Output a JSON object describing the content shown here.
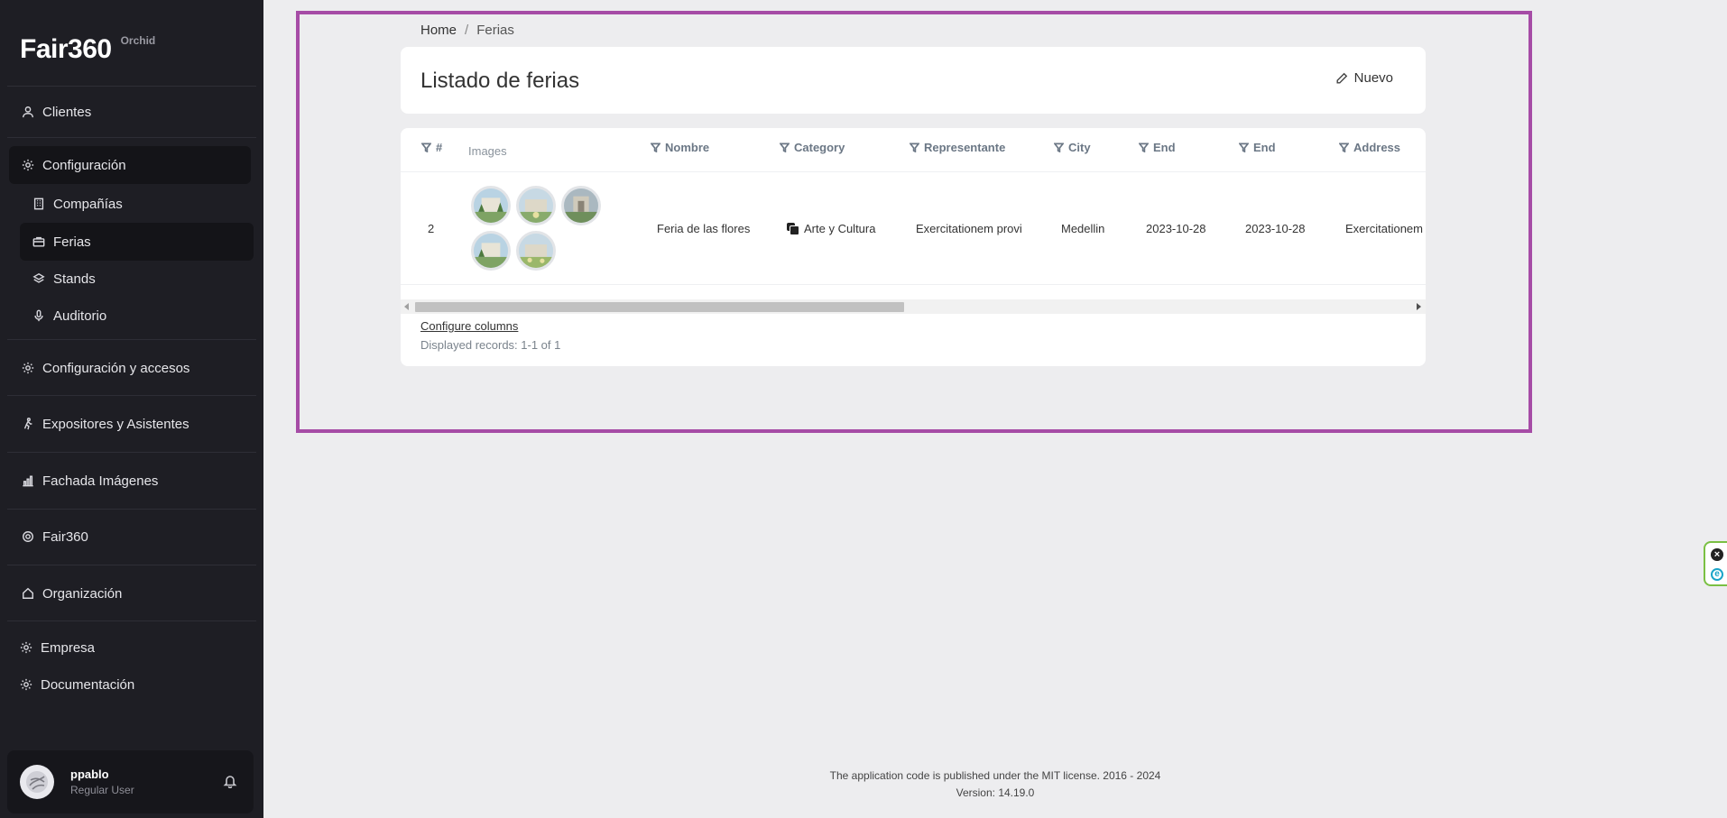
{
  "brand": {
    "name": "Fair360",
    "sub": "Orchid"
  },
  "sidebar": {
    "items": [
      {
        "label": "Clientes",
        "icon": "user-icon"
      },
      {
        "label": "Configuración",
        "icon": "gear-icon"
      },
      {
        "label": "Compañías",
        "icon": "building-icon"
      },
      {
        "label": "Ferias",
        "icon": "briefcase-icon"
      },
      {
        "label": "Stands",
        "icon": "layers-icon"
      },
      {
        "label": "Auditorio",
        "icon": "microphone-icon"
      },
      {
        "label": "Configuración y accesos",
        "icon": "gear-icon"
      },
      {
        "label": "Expositores y Asistentes",
        "icon": "walking-person-icon"
      },
      {
        "label": "Fachada Imágenes",
        "icon": "chart-icon"
      },
      {
        "label": "Fair360",
        "icon": "circle-icon"
      },
      {
        "label": "Organización",
        "icon": "home-icon"
      },
      {
        "label": "Empresa",
        "icon": "gear-icon"
      },
      {
        "label": "Documentación",
        "icon": "gear-icon"
      }
    ]
  },
  "user": {
    "name": "ppablo",
    "role": "Regular User"
  },
  "breadcrumb": {
    "home": "Home",
    "separator": "/",
    "current": "Ferias"
  },
  "page": {
    "title": "Listado de ferias",
    "new_label": "Nuevo"
  },
  "table": {
    "columns": [
      "#",
      "Images",
      "Nombre",
      "Category",
      "Representante",
      "City",
      "End",
      "End",
      "Address"
    ],
    "rows": [
      {
        "id": "2",
        "image_count": 5,
        "nombre": "Feria de las flores",
        "category": "Arte y Cultura",
        "representante": "Exercitationem provi",
        "city": "Medellin",
        "end1": "2023-10-28",
        "end2": "2023-10-28",
        "address": "Exercitationem"
      }
    ],
    "configure_label": "Configure columns",
    "records_label": "Displayed records: 1-1 of 1"
  },
  "footer": {
    "license": "The application code is published under the MIT license. 2016 - 2024",
    "version": "Version: 14.19.0"
  },
  "colors": {
    "sidebar_bg": "#1e1e24",
    "highlight": "#a64ca6",
    "page_bg": "#ededef"
  }
}
